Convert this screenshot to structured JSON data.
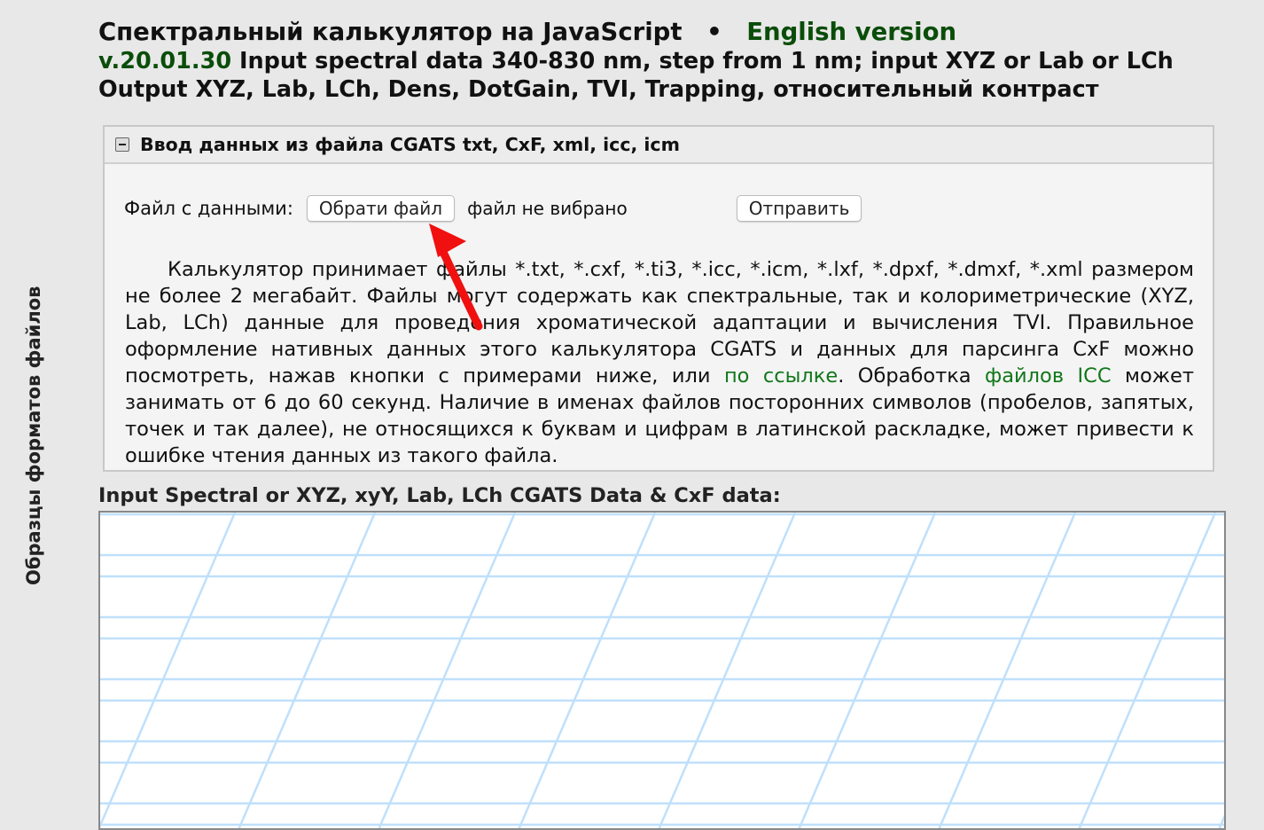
{
  "sidebar": {
    "vertical_label": "Образцы форматов файлов"
  },
  "header": {
    "title": "Спектральный калькулятор на JavaScript",
    "bullet": "•",
    "english_link": "English version",
    "version": "v.20.01.30",
    "line2": "Input spectral data 340-830 nm, step from 1 nm; input XYZ or Lab or LCh",
    "line3": "Output XYZ, Lab, LCh, Dens, DotGain, TVI, Trapping, относительный контраст"
  },
  "panel": {
    "title": "Ввод данных из файла CGATS txt, CxF, xml, icc, icm",
    "file_label": "Файл с данными:",
    "choose_button": "Обрати файл",
    "file_status": "файл не вибрано",
    "submit_button": "Отправить",
    "desc_part1": "Калькулятор принимает файлы *.txt, *.cxf, *.ti3, *.icc, *.icm, *.lxf, *.dpxf, *.dmxf, *.xml размером не более 2 мегабайт. Файлы могут содержать как спектральные, так и колориметрические (XYZ, Lab, LCh) данные для проведения хроматической адаптации и вычисления TVI. Правильное оформление нативных данных этого калькулятора CGATS и данных для парсинга CxF можно посмотреть, нажав кнопки с примерами ниже, или ",
    "link1": "по ссылке",
    "desc_part2": ". Обработка ",
    "link2": "файлов ICC",
    "desc_part3": " может занимать от 6 до 60 секунд. Наличие в именах файлов посторонних символов (пробелов, запятых, точек и так далее), не относящихся к буквам и цифрам в латинской раскладке, может привести к ошибке чтения данных из такого файла."
  },
  "input": {
    "label": "Input Spectral or XYZ, xyY, Lab, LCh CGATS Data & CxF data:",
    "value": ""
  },
  "colors": {
    "accent_green": "#0a4d0a",
    "link_green": "#11771a",
    "grid_blue": "#bfe0fb",
    "annotation_red": "#f01010"
  }
}
